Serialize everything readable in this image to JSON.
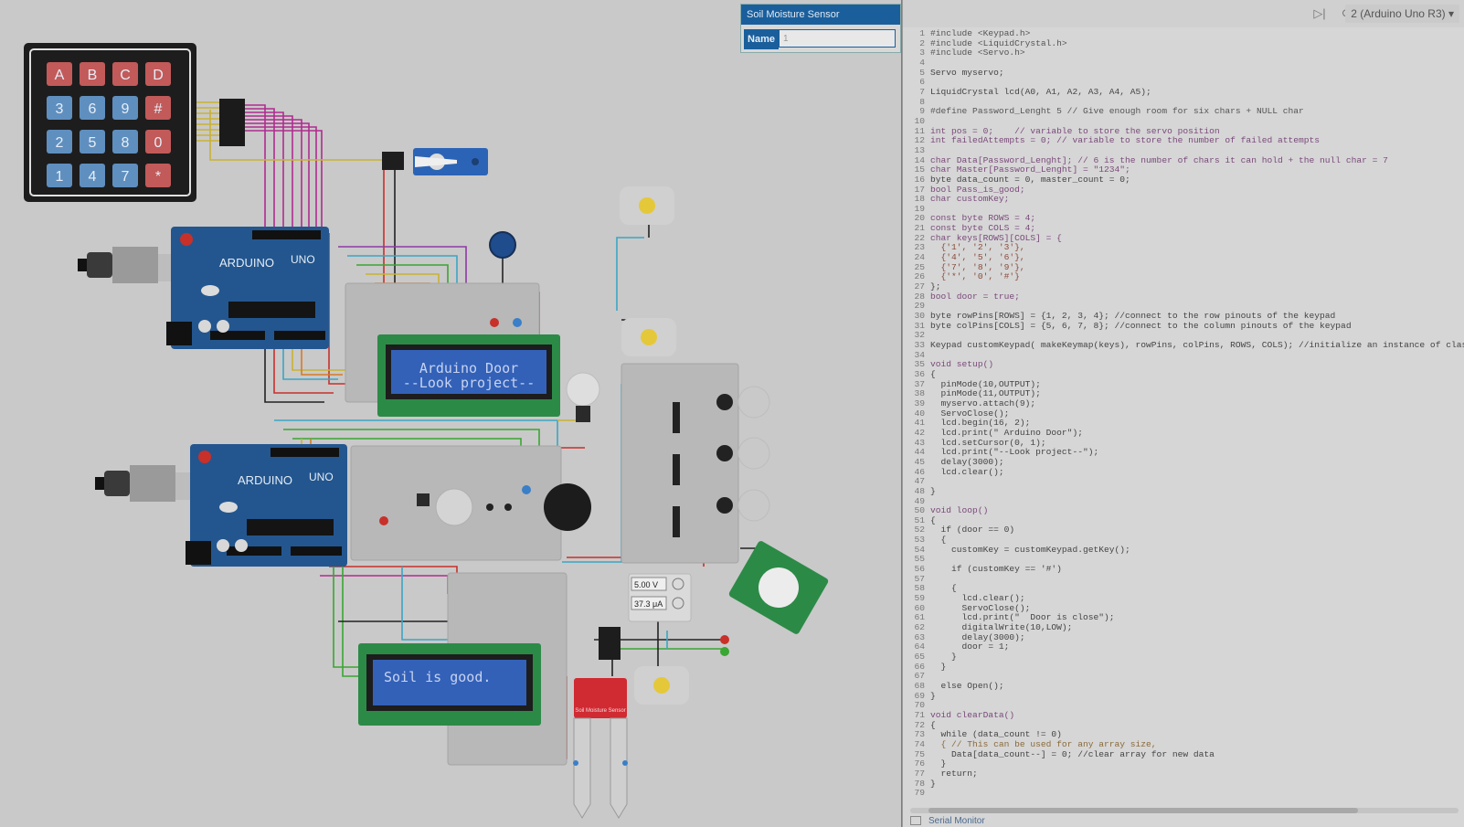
{
  "toolbar": {
    "step_icon": "step-over-icon",
    "restart_icon": "restart-icon",
    "board_select": "2 (Arduino Uno R3)"
  },
  "properties": {
    "title": "Soil Moisture Sensor",
    "name_label": "Name",
    "name_value": "1"
  },
  "circuit": {
    "keypad_keys": [
      [
        "A",
        "B",
        "C",
        "D"
      ],
      [
        "3",
        "6",
        "9",
        "#"
      ],
      [
        "2",
        "5",
        "8",
        "0"
      ],
      [
        "1",
        "4",
        "7",
        "*"
      ]
    ],
    "lcd1_line1": "Arduino Door",
    "lcd1_line2": "--Look project--",
    "lcd2_line1": "Soil is good.",
    "multimeter_voltage": "5.00 V",
    "multimeter_current": "37.3 μA",
    "arduino_label": "UNO",
    "arduino_brand": "ARDUINO",
    "soil_sensor_label": "Soil Moisture Sensor"
  },
  "code_lines": [
    {
      "n": "1",
      "t": "#include <Keypad.h>",
      "c": "pp"
    },
    {
      "n": "2",
      "t": "#include <LiquidCrystal.h>",
      "c": "pp"
    },
    {
      "n": "3",
      "t": "#include <Servo.h>",
      "c": "pp"
    },
    {
      "n": "4",
      "t": "",
      "c": ""
    },
    {
      "n": "5",
      "t": "Servo myservo;",
      "c": ""
    },
    {
      "n": "6",
      "t": "",
      "c": ""
    },
    {
      "n": "7",
      "t": "LiquidCrystal lcd(A0, A1, A2, A3, A4, A5);",
      "c": ""
    },
    {
      "n": "8",
      "t": "",
      "c": ""
    },
    {
      "n": "9",
      "t": "#define Password_Lenght 5 // Give enough room for six chars + NULL char",
      "c": "pp"
    },
    {
      "n": "10",
      "t": "",
      "c": ""
    },
    {
      "n": "11",
      "t": "int pos = 0;    // variable to store the servo position",
      "c": "kw"
    },
    {
      "n": "12",
      "t": "int failedAttempts = 0; // variable to store the number of failed attempts",
      "c": "kw"
    },
    {
      "n": "13",
      "t": "",
      "c": ""
    },
    {
      "n": "14",
      "t": "char Data[Password_Lenght]; // 6 is the number of chars it can hold + the null char = 7",
      "c": "kw"
    },
    {
      "n": "15",
      "t": "char Master[Password_Lenght] = \"1234\";",
      "c": "kw"
    },
    {
      "n": "16",
      "t": "byte data_count = 0, master_count = 0;",
      "c": ""
    },
    {
      "n": "17",
      "t": "bool Pass_is_good;",
      "c": "kw"
    },
    {
      "n": "18",
      "t": "char customKey;",
      "c": "kw"
    },
    {
      "n": "19",
      "t": "",
      "c": ""
    },
    {
      "n": "20",
      "t": "const byte ROWS = 4;",
      "c": "kw"
    },
    {
      "n": "21",
      "t": "const byte COLS = 4;",
      "c": "kw"
    },
    {
      "n": "22",
      "t": "char keys[ROWS][COLS] = {",
      "c": "kw"
    },
    {
      "n": "23",
      "t": "  {'1', '2', '3'},",
      "c": "st"
    },
    {
      "n": "24",
      "t": "  {'4', '5', '6'},",
      "c": "st"
    },
    {
      "n": "25",
      "t": "  {'7', '8', '9'},",
      "c": "st"
    },
    {
      "n": "26",
      "t": "  {'*', '0', '#'}",
      "c": "st"
    },
    {
      "n": "27",
      "t": "};",
      "c": ""
    },
    {
      "n": "28",
      "t": "bool door = true;",
      "c": "kw"
    },
    {
      "n": "29",
      "t": "",
      "c": ""
    },
    {
      "n": "30",
      "t": "byte rowPins[ROWS] = {1, 2, 3, 4}; //connect to the row pinouts of the keypad",
      "c": ""
    },
    {
      "n": "31",
      "t": "byte colPins[COLS] = {5, 6, 7, 8}; //connect to the column pinouts of the keypad",
      "c": ""
    },
    {
      "n": "32",
      "t": "",
      "c": ""
    },
    {
      "n": "33",
      "t": "Keypad customKeypad( makeKeymap(keys), rowPins, colPins, ROWS, COLS); //initialize an instance of class",
      "c": ""
    },
    {
      "n": "34",
      "t": "",
      "c": ""
    },
    {
      "n": "35",
      "t": "void setup()",
      "c": "kw"
    },
    {
      "n": "36",
      "t": "{",
      "c": ""
    },
    {
      "n": "37",
      "t": "  pinMode(10,OUTPUT);",
      "c": ""
    },
    {
      "n": "38",
      "t": "  pinMode(11,OUTPUT);",
      "c": ""
    },
    {
      "n": "39",
      "t": "  myservo.attach(9);",
      "c": ""
    },
    {
      "n": "40",
      "t": "  ServoClose();",
      "c": ""
    },
    {
      "n": "41",
      "t": "  lcd.begin(16, 2);",
      "c": ""
    },
    {
      "n": "42",
      "t": "  lcd.print(\" Arduino Door\");",
      "c": ""
    },
    {
      "n": "43",
      "t": "  lcd.setCursor(0, 1);",
      "c": ""
    },
    {
      "n": "44",
      "t": "  lcd.print(\"--Look project--\");",
      "c": ""
    },
    {
      "n": "45",
      "t": "  delay(3000);",
      "c": ""
    },
    {
      "n": "46",
      "t": "  lcd.clear();",
      "c": ""
    },
    {
      "n": "47",
      "t": "",
      "c": ""
    },
    {
      "n": "48",
      "t": "}",
      "c": ""
    },
    {
      "n": "49",
      "t": "",
      "c": ""
    },
    {
      "n": "50",
      "t": "void loop()",
      "c": "kw"
    },
    {
      "n": "51",
      "t": "{",
      "c": ""
    },
    {
      "n": "52",
      "t": "  if (door == 0)",
      "c": ""
    },
    {
      "n": "53",
      "t": "  {",
      "c": ""
    },
    {
      "n": "54",
      "t": "    customKey = customKeypad.getKey();",
      "c": ""
    },
    {
      "n": "55",
      "t": "",
      "c": ""
    },
    {
      "n": "56",
      "t": "    if (customKey == '#')",
      "c": ""
    },
    {
      "n": "57",
      "t": "",
      "c": ""
    },
    {
      "n": "58",
      "t": "    {",
      "c": ""
    },
    {
      "n": "59",
      "t": "      lcd.clear();",
      "c": ""
    },
    {
      "n": "60",
      "t": "      ServoClose();",
      "c": ""
    },
    {
      "n": "61",
      "t": "      lcd.print(\"  Door is close\");",
      "c": ""
    },
    {
      "n": "62",
      "t": "      digitalWrite(10,LOW);",
      "c": ""
    },
    {
      "n": "63",
      "t": "      delay(3000);",
      "c": ""
    },
    {
      "n": "64",
      "t": "      door = 1;",
      "c": ""
    },
    {
      "n": "65",
      "t": "    }",
      "c": ""
    },
    {
      "n": "66",
      "t": "  }",
      "c": ""
    },
    {
      "n": "67",
      "t": "",
      "c": ""
    },
    {
      "n": "68",
      "t": "  else Open();",
      "c": ""
    },
    {
      "n": "69",
      "t": "}",
      "c": ""
    },
    {
      "n": "70",
      "t": "",
      "c": ""
    },
    {
      "n": "71",
      "t": "void clearData()",
      "c": "kw"
    },
    {
      "n": "72",
      "t": "{",
      "c": ""
    },
    {
      "n": "73",
      "t": "  while (data_count != 0)",
      "c": ""
    },
    {
      "n": "74",
      "t": "  { // This can be used for any array size,",
      "c": "cm"
    },
    {
      "n": "75",
      "t": "    Data[data_count--] = 0; //clear array for new data",
      "c": ""
    },
    {
      "n": "76",
      "t": "  }",
      "c": ""
    },
    {
      "n": "77",
      "t": "  return;",
      "c": ""
    },
    {
      "n": "78",
      "t": "}",
      "c": ""
    },
    {
      "n": "79",
      "t": "",
      "c": ""
    }
  ],
  "serial_monitor_label": "Serial Monitor"
}
